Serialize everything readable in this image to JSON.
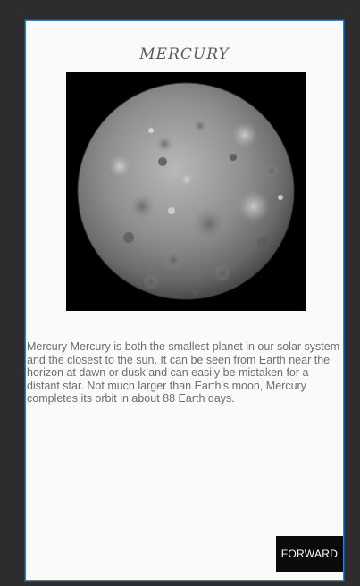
{
  "app": {
    "title": "MERCURY",
    "image_alt": "Mercury planet photo",
    "description": " Mercury Mercury is both the smallest planet in our solar system and the closest to the sun. It can be seen from Earth near the horizon at dawn or dusk and can easily be mistaken for a distant star. Not much larger than Earth's moon, Mercury completes its orbit in about 88 Earth days.",
    "forward_label": "FORWARD"
  },
  "colors": {
    "accent_border": "#2f7fd8",
    "button_bg": "#0a0a0a",
    "button_text": "#ffffff",
    "text": "#6d6d6d"
  },
  "icons": {
    "planet": "planet-mercury-image"
  }
}
